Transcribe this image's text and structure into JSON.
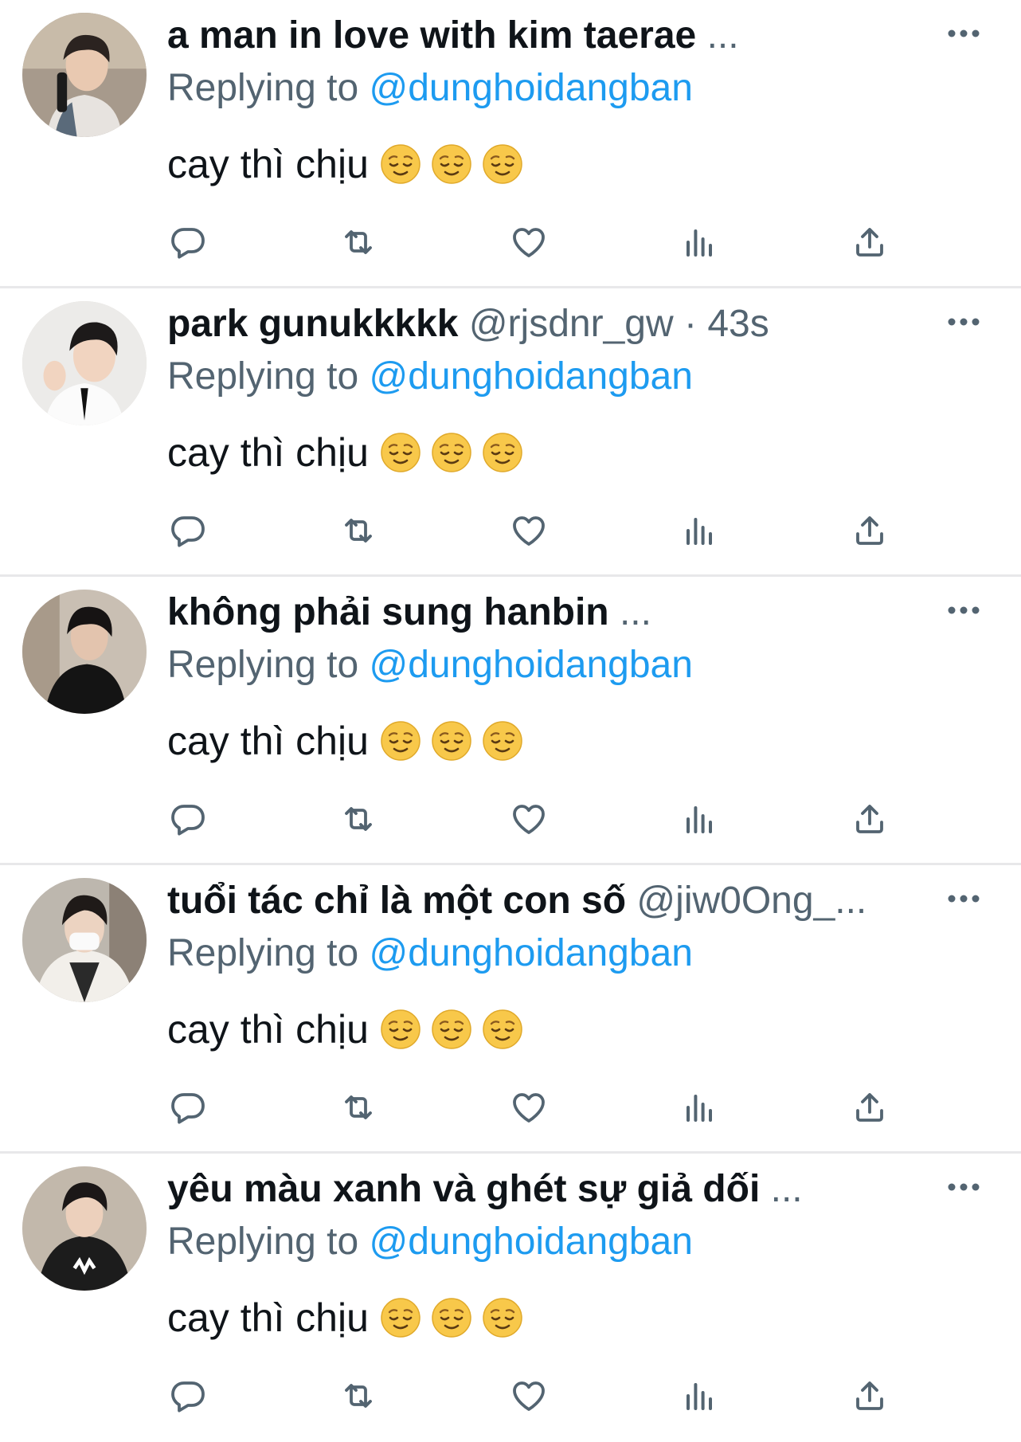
{
  "colors": {
    "text": "#0f1419",
    "secondary": "#536471",
    "accent": "#1d9bf0",
    "divider": "#e8e8ea"
  },
  "tweets": [
    {
      "display_name": "a man in love with kim taerae",
      "handle": "",
      "separator": "",
      "time": "",
      "truncated": "...",
      "reply_prefix": "Replying to",
      "reply_to": "@dunghoidangban",
      "text": "cay thì chịu",
      "emoji": "relieved-face-emoji"
    },
    {
      "display_name": "park gunukkkkk",
      "handle": "@rjsdnr_gw",
      "separator": "·",
      "time": "43s",
      "truncated": "",
      "reply_prefix": "Replying to",
      "reply_to": "@dunghoidangban",
      "text": "cay thì chịu",
      "emoji": "relieved-face-emoji"
    },
    {
      "display_name": "không phải sung hanbin",
      "handle": "",
      "separator": "",
      "time": "",
      "truncated": "...",
      "reply_prefix": "Replying to",
      "reply_to": "@dunghoidangban",
      "text": "cay thì chịu",
      "emoji": "relieved-face-emoji"
    },
    {
      "display_name": "tuổi tác chỉ là một con số",
      "handle": "@jiw0Ong_...",
      "separator": "",
      "time": "",
      "truncated": "",
      "reply_prefix": "Replying to",
      "reply_to": "@dunghoidangban",
      "text": "cay thì chịu",
      "emoji": "relieved-face-emoji"
    },
    {
      "display_name": "yêu màu xanh và ghét sự giả dối",
      "handle": "",
      "separator": "",
      "time": "",
      "truncated": "...",
      "reply_prefix": "Replying to",
      "reply_to": "@dunghoidangban",
      "text": "cay thì chịu",
      "emoji": "relieved-face-emoji"
    }
  ],
  "icons": {
    "more": "more-horizontal-icon",
    "reply": "reply-bubble-icon",
    "retweet": "retweet-icon",
    "like": "heart-icon",
    "views": "views-bar-chart-icon",
    "share": "share-upload-icon"
  }
}
